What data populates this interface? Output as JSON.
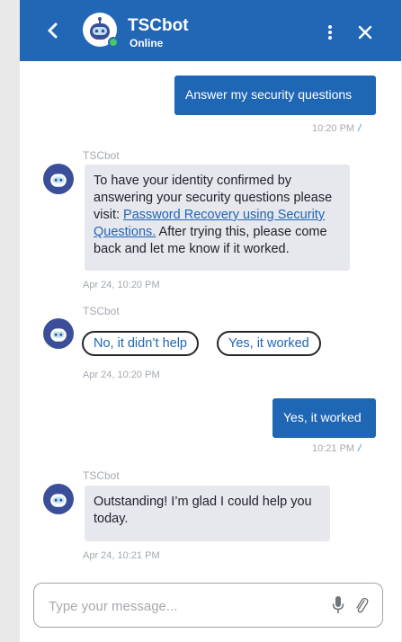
{
  "header": {
    "bot_name": "TSCbot",
    "status": "Online",
    "brand_color": "#2167b5",
    "status_color": "#4cc46b"
  },
  "messages": [
    {
      "from": "user",
      "text": "Answer my security questions",
      "time": "10:20 PM"
    },
    {
      "from": "bot",
      "sender": "TSCbot",
      "text_before": "To have your identity confirmed by answering your security questions please visit: ",
      "link": "Password Recovery using Security Questions.",
      "text_after": " After trying this, please come back and let me know if it worked.",
      "time": "Apr 24, 10:20 PM"
    },
    {
      "from": "bot",
      "sender": "TSCbot",
      "quick_replies": [
        "No, it didn’t help",
        "Yes, it worked"
      ],
      "time": "Apr 24, 10:20 PM"
    },
    {
      "from": "user",
      "text": "Yes, it worked",
      "time": "10:21 PM"
    },
    {
      "from": "bot",
      "sender": "TSCbot",
      "text": "Outstanding! I’m glad I could help you today.",
      "time": "Apr 24, 10:21 PM"
    }
  ],
  "composer": {
    "placeholder": "Type your message...",
    "icons": [
      "microphone-icon",
      "paperclip-icon"
    ]
  }
}
